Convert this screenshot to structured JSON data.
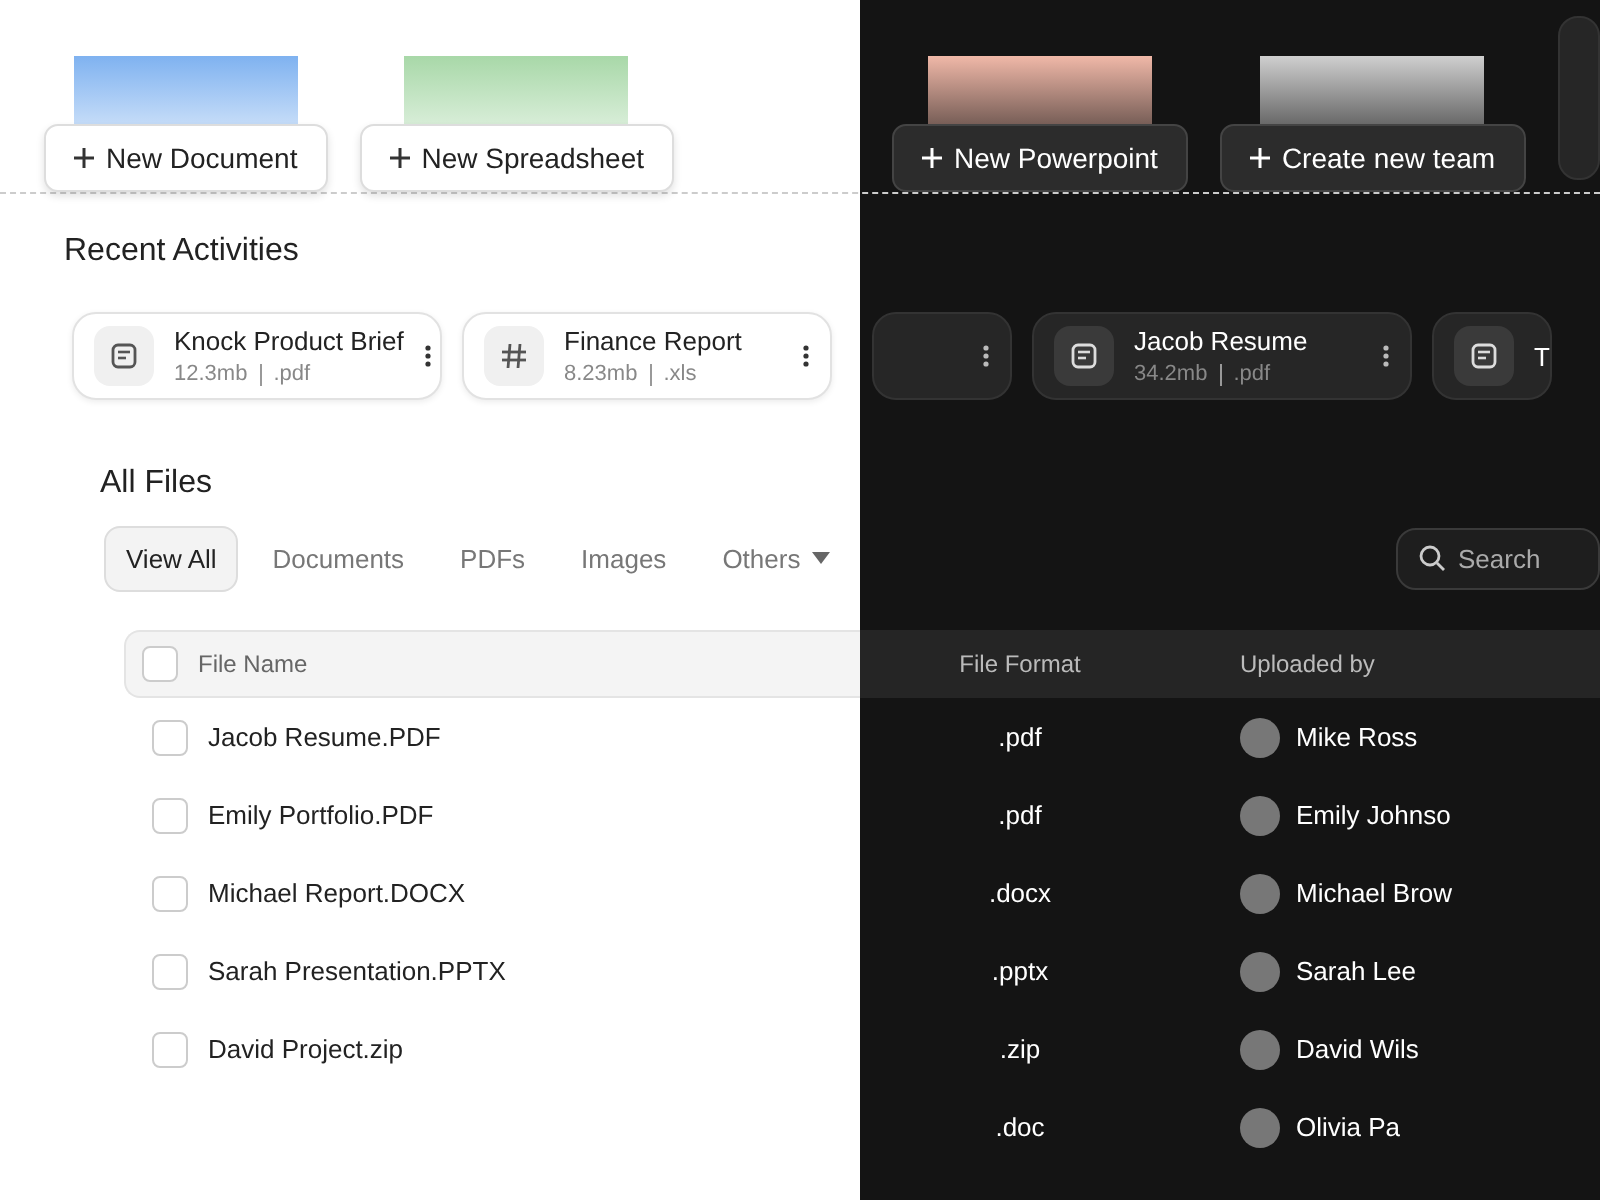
{
  "light_mode": {
    "create_buttons": [
      {
        "label": "New Document",
        "color": "#7fb2f0"
      },
      {
        "label": "New Spreadsheet",
        "color": "#a8d8a8"
      }
    ],
    "recent_files": [
      {
        "name": "Knock Product Brief",
        "size": "12.3mb",
        "ext": ".pdf",
        "kind": "document"
      },
      {
        "name": "Finance Report",
        "size": "8.23mb",
        "ext": ".xls",
        "kind": "sheet"
      }
    ]
  },
  "dark_mode": {
    "create_buttons": [
      {
        "label": "New Powerpoint",
        "color": "#f0b8a8"
      },
      {
        "label": "Create new team",
        "color": "#cfcfcf"
      }
    ],
    "recent_files": [
      {
        "kind": "blank"
      },
      {
        "name": "Jacob Resume",
        "size": "34.2mb",
        "ext": ".pdf",
        "kind": "document"
      },
      {
        "name": "T",
        "kind": "document"
      }
    ]
  },
  "recent_title": "Recent Activities",
  "all_files": {
    "title": "All Files",
    "tabs": [
      {
        "label": "View All",
        "selected": true,
        "dropdown": false
      },
      {
        "label": "Documents",
        "selected": false,
        "dropdown": false
      },
      {
        "label": "PDFs",
        "selected": false,
        "dropdown": false
      },
      {
        "label": "Images",
        "selected": false,
        "dropdown": false
      },
      {
        "label": "Others",
        "selected": false,
        "dropdown": true
      }
    ],
    "search": {
      "placeholder": "Search"
    }
  },
  "table": {
    "columns": [
      "File Name",
      "File Format",
      "Uploaded by"
    ],
    "header_checked": false,
    "rows": [
      {
        "file": "Jacob Resume.PDF",
        "checked": false,
        "format": ".pdf",
        "uploader": "Mike Ross"
      },
      {
        "file": "Emily Portfolio.PDF",
        "checked": false,
        "format": ".pdf",
        "uploader": "Emily Johnso"
      },
      {
        "file": "Michael Report.DOCX",
        "checked": false,
        "format": ".docx",
        "uploader": "Michael Brow"
      },
      {
        "file": "Sarah Presentation.PPTX",
        "checked": false,
        "format": ".pptx",
        "uploader": "Sarah Lee"
      },
      {
        "file": "David Project.zip",
        "checked": false,
        "format": ".zip",
        "uploader": "David Wils"
      },
      {
        "format": ".doc",
        "uploader": "Olivia Pa"
      }
    ]
  }
}
